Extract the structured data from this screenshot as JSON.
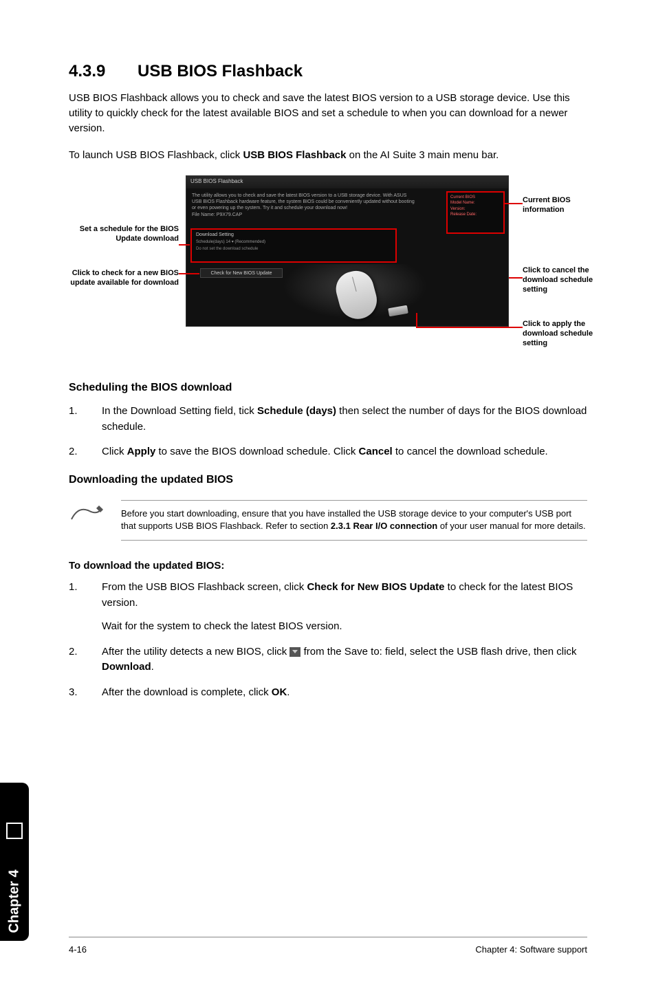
{
  "section": {
    "number": "4.3.9",
    "title": "USB BIOS Flashback",
    "intro": "USB BIOS Flashback allows you to check and save the latest BIOS version to a USB storage device. Use this utility to quickly check for the latest available BIOS and set a schedule to when you can download for a newer version.",
    "launch_pre": "To launch USB BIOS Flashback, click ",
    "launch_bold": "USB BIOS Flashback",
    "launch_post": " on the AI Suite 3 main menu bar."
  },
  "figure": {
    "callout_left_1": "Set a schedule for the BIOS Update download",
    "callout_left_2": "Click to check for a new BIOS update available for download",
    "callout_right_1": "Current BIOS information",
    "callout_right_2": "Click to cancel the download schedule setting",
    "callout_right_3": "Click to apply the download schedule setting",
    "shot_title": "USB BIOS Flashback",
    "shot_sched_hdr": "Download Setting",
    "shot_sched_line": "Schedule(days)     14   ▾   (Recommended)",
    "shot_sched_sub": "Do not set the download schedule",
    "shot_check_btn": "Check for New BIOS Update",
    "shot_side_hdr": "Current BIOS",
    "shot_side_model": "Model Name:",
    "shot_side_ver": "Version:",
    "shot_side_date": "Release Date:"
  },
  "scheduling": {
    "heading": "Scheduling the BIOS download",
    "step1_pre": "In the Download Setting field, tick ",
    "step1_bold": "Schedule (days)",
    "step1_post": " then select the number of days for the BIOS download schedule.",
    "step2_pre": "Click ",
    "step2_bold1": "Apply",
    "step2_mid": " to save the BIOS download schedule. Click ",
    "step2_bold2": "Cancel",
    "step2_post": " to cancel the download schedule."
  },
  "downloading": {
    "heading": "Downloading the updated BIOS",
    "note_pre": "Before you start downloading, ensure that you have installed the USB storage device to your computer's USB port that supports USB BIOS Flashback. Refer to section ",
    "note_bold": "2.3.1 Rear I/O connection",
    "note_post": " of your user manual for more details.",
    "to_label": "To download the updated BIOS:",
    "step1_pre": "From the USB BIOS Flashback screen, click ",
    "step1_bold": "Check for New BIOS Update",
    "step1_post": " to check for the latest BIOS version.",
    "step1_wait": "Wait for the system to check the latest BIOS version.",
    "step2_pre": "After the utility detects a new BIOS, click ",
    "step2_mid": " from the Save to: field, select the USB flash drive, then click ",
    "step2_bold": "Download",
    "step2_post": ".",
    "step3_pre": "After the download is complete, click ",
    "step3_bold": "OK",
    "step3_post": "."
  },
  "footer": {
    "page": "4-16",
    "chapter": "Chapter 4: Software support"
  },
  "sidetab": "Chapter 4"
}
